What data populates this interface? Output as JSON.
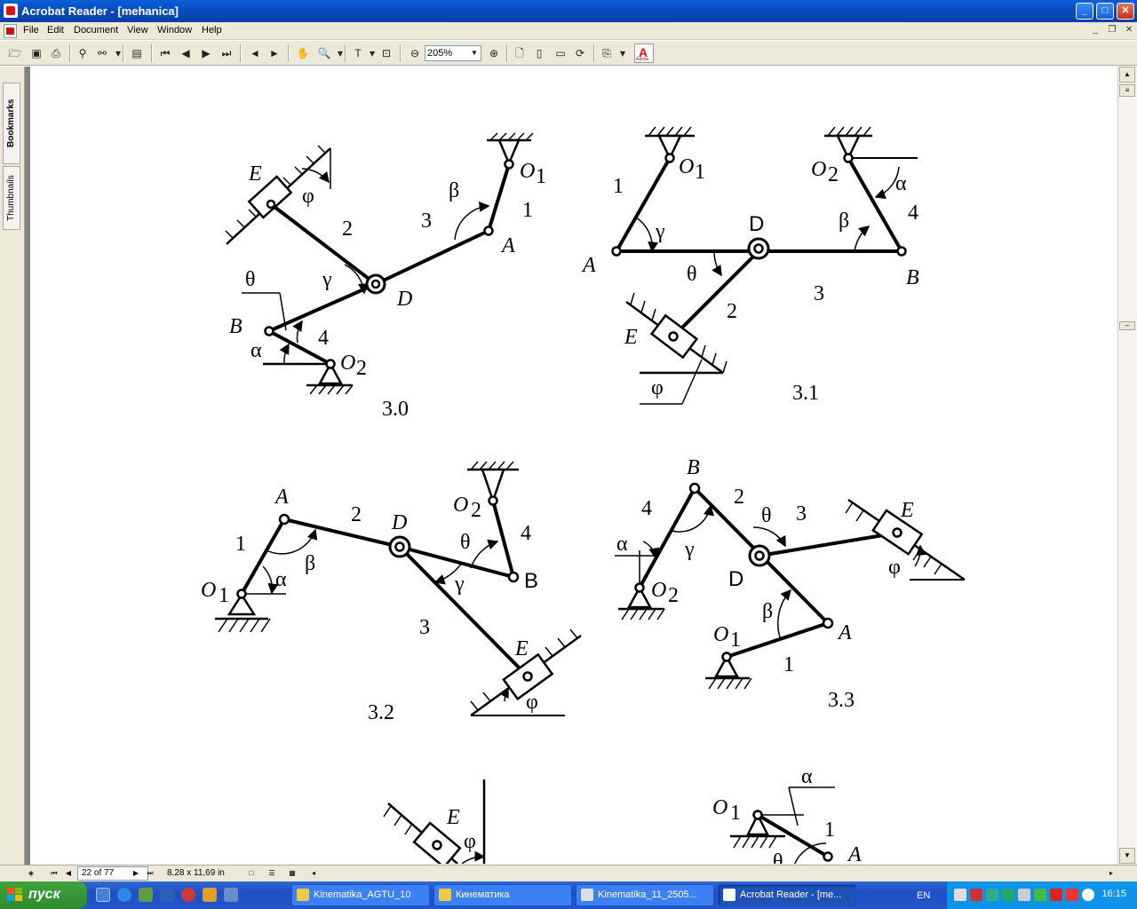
{
  "window": {
    "title": "Acrobat Reader - [mehanica]",
    "buttons": {
      "minimize": "_",
      "maximize": "□",
      "close": "✕"
    }
  },
  "menu": {
    "items": [
      "File",
      "Edit",
      "Document",
      "View",
      "Window",
      "Help"
    ]
  },
  "toolbar": {
    "zoom_value": "205%"
  },
  "sidebar": {
    "tabs": [
      "Bookmarks",
      "Thumbnails"
    ]
  },
  "statusbar": {
    "page_indicator": "22 of 77",
    "page_size": "8,28 x 11,69 in"
  },
  "figures": {
    "f30": {
      "caption": "3.0",
      "labels": {
        "E": "E",
        "phi": "φ",
        "two": "2",
        "three": "3",
        "beta": "β",
        "one": "1",
        "O1": "O",
        "O1sub": "1",
        "A": "A",
        "theta": "θ",
        "gamma": "γ",
        "D": "D",
        "B": "B",
        "four": "4",
        "alpha": "α",
        "O2": "O",
        "O2sub": "2"
      }
    },
    "f31": {
      "caption": "3.1",
      "labels": {
        "O1": "O",
        "O1sub": "1",
        "one": "1",
        "gamma": "γ",
        "A": "A",
        "D": "D",
        "O2": "O",
        "O2sub": "2",
        "alpha": "α",
        "beta": "β",
        "four": "4",
        "B": "B",
        "theta": "θ",
        "two": "2",
        "three": "3",
        "E": "E",
        "phi": "φ"
      }
    },
    "f32": {
      "caption": "3.2",
      "labels": {
        "A": "A",
        "two": "2",
        "D": "D",
        "O2": "O",
        "O2sub": "2",
        "four": "4",
        "one": "1",
        "beta": "β",
        "theta": "θ",
        "O1": "O",
        "O1sub": "1",
        "alpha": "α",
        "gamma": "γ",
        "B": "B",
        "three": "3",
        "E": "E",
        "phi": "φ"
      }
    },
    "f33": {
      "caption": "3.3",
      "labels": {
        "B": "B",
        "two": "2",
        "four": "4",
        "theta": "θ",
        "three": "3",
        "E": "E",
        "alpha": "α",
        "gamma": "γ",
        "O2": "O",
        "O2sub": "2",
        "D": "D",
        "phi": "φ",
        "beta": "β",
        "O1": "O",
        "O1sub": "1",
        "A": "A",
        "one": "1"
      }
    },
    "f34": {
      "labels": {
        "E": "E",
        "phi": "φ"
      }
    },
    "f35": {
      "labels": {
        "alpha": "α",
        "O1": "O",
        "O1sub": "1",
        "one": "1",
        "A": "A",
        "theta": "θ"
      }
    }
  },
  "taskbar": {
    "start_label": "пуск",
    "tasks": [
      "Kinematika_AGTU_10",
      "Кинематика",
      "Kinematika_11_2505...",
      "Acrobat Reader - [me..."
    ],
    "language": "EN",
    "clock": "16:15"
  }
}
